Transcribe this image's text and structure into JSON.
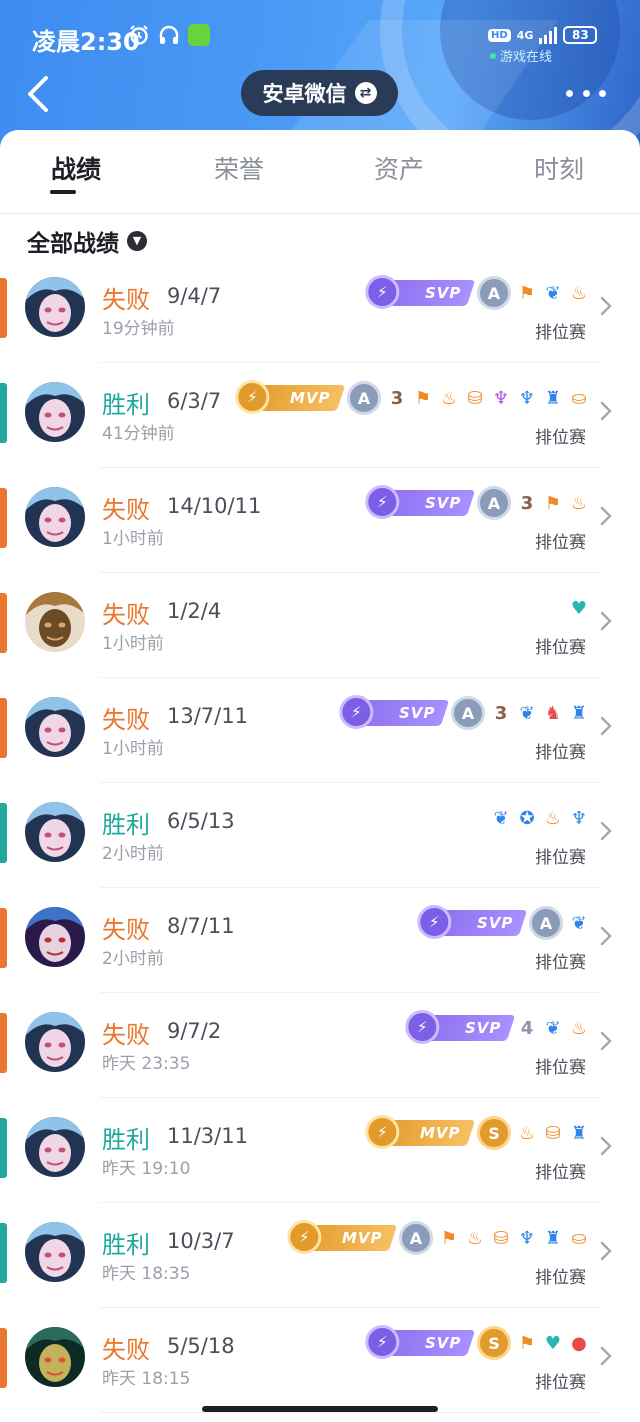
{
  "status_bar": {
    "time": "凌晨2:30",
    "icons": [
      "alarm-icon",
      "headset-icon",
      "app-icon"
    ],
    "hd_label": "HD",
    "network": "4G",
    "battery": "83",
    "online_label": "游戏在线"
  },
  "header": {
    "account_switch_label": "安卓微信",
    "icons": [
      "back-arrow-icon",
      "swap-icon",
      "more-dots-icon"
    ]
  },
  "tabs": [
    {
      "label": "战绩",
      "active": true
    },
    {
      "label": "荣誉",
      "active": false
    },
    {
      "label": "资产",
      "active": false
    },
    {
      "label": "时刻",
      "active": false
    }
  ],
  "filter": {
    "label": "全部战绩"
  },
  "colors": {
    "win": "#21a99e",
    "loss": "#e9772d",
    "svp": "#8b6ef0",
    "mvp": "#e39a2c",
    "header": "#3d8cf0"
  },
  "matches": [
    {
      "result": "失败",
      "outcome": "loss",
      "kda": "9/4/7",
      "time": "19分钟前",
      "mode": "排位赛",
      "hero": "jinx",
      "badges": [
        {
          "type": "svp",
          "text": "SVP"
        },
        {
          "type": "grade-a",
          "text": "A"
        },
        {
          "type": "icon",
          "name": "flag-icon",
          "color": "o"
        },
        {
          "type": "icon",
          "name": "wing-icon",
          "color": "b"
        },
        {
          "type": "icon",
          "name": "fire-icon",
          "color": "o"
        }
      ]
    },
    {
      "result": "胜利",
      "outcome": "win",
      "kda": "6/3/7",
      "time": "41分钟前",
      "mode": "排位赛",
      "hero": "jinx",
      "badges": [
        {
          "type": "mvp",
          "text": "MVP"
        },
        {
          "type": "grade-a",
          "text": "A"
        },
        {
          "type": "number",
          "text": "3"
        },
        {
          "type": "icon",
          "name": "flag-icon",
          "color": "o"
        },
        {
          "type": "icon",
          "name": "fire-icon",
          "color": "o"
        },
        {
          "type": "icon",
          "name": "coins-icon",
          "color": "o"
        },
        {
          "type": "icon",
          "name": "demon-icon",
          "color": "p"
        },
        {
          "type": "icon",
          "name": "bird-icon",
          "color": "b"
        },
        {
          "type": "icon",
          "name": "tower-icon",
          "color": "b"
        },
        {
          "type": "icon",
          "name": "gold-icon",
          "color": "o"
        }
      ]
    },
    {
      "result": "失败",
      "outcome": "loss",
      "kda": "14/10/11",
      "time": "1小时前",
      "mode": "排位赛",
      "hero": "jinx",
      "badges": [
        {
          "type": "svp",
          "text": "SVP"
        },
        {
          "type": "grade-a",
          "text": "A"
        },
        {
          "type": "number",
          "text": "3"
        },
        {
          "type": "icon",
          "name": "flag-icon",
          "color": "o"
        },
        {
          "type": "icon",
          "name": "fire-icon",
          "color": "o"
        }
      ]
    },
    {
      "result": "失败",
      "outcome": "loss",
      "kda": "1/2/4",
      "time": "1小时前",
      "mode": "排位赛",
      "hero": "warrior",
      "badges": [
        {
          "type": "icon",
          "name": "heal-heart-icon",
          "color": "t"
        }
      ]
    },
    {
      "result": "失败",
      "outcome": "loss",
      "kda": "13/7/11",
      "time": "1小时前",
      "mode": "排位赛",
      "hero": "jinx",
      "badges": [
        {
          "type": "svp",
          "text": "SVP"
        },
        {
          "type": "grade-a",
          "text": "A"
        },
        {
          "type": "number",
          "text": "3"
        },
        {
          "type": "icon",
          "name": "wing-icon",
          "color": "b"
        },
        {
          "type": "icon",
          "name": "claw-icon",
          "color": "r"
        },
        {
          "type": "icon",
          "name": "tower-icon",
          "color": "b"
        }
      ]
    },
    {
      "result": "胜利",
      "outcome": "win",
      "kda": "6/5/13",
      "time": "2小时前",
      "mode": "排位赛",
      "hero": "jinx",
      "badges": [
        {
          "type": "icon",
          "name": "wing-icon",
          "color": "b"
        },
        {
          "type": "icon",
          "name": "shield-wing-icon",
          "color": "b"
        },
        {
          "type": "icon",
          "name": "fire-icon",
          "color": "o"
        },
        {
          "type": "icon",
          "name": "bird-icon",
          "color": "b"
        }
      ]
    },
    {
      "result": "失败",
      "outcome": "loss",
      "kda": "8/7/11",
      "time": "2小时前",
      "mode": "排位赛",
      "hero": "mage",
      "badges": [
        {
          "type": "svp",
          "text": "SVP"
        },
        {
          "type": "grade-a",
          "text": "A"
        },
        {
          "type": "icon",
          "name": "wing-icon",
          "color": "b"
        }
      ]
    },
    {
      "result": "失败",
      "outcome": "loss",
      "kda": "9/7/2",
      "time": "昨天 23:35",
      "mode": "排位赛",
      "hero": "jinx",
      "badges": [
        {
          "type": "svp",
          "text": "SVP"
        },
        {
          "type": "number",
          "text": "4",
          "color": "g"
        },
        {
          "type": "icon",
          "name": "wing-icon",
          "color": "b"
        },
        {
          "type": "icon",
          "name": "fire-icon",
          "color": "o"
        }
      ]
    },
    {
      "result": "胜利",
      "outcome": "win",
      "kda": "11/3/11",
      "time": "昨天 19:10",
      "mode": "排位赛",
      "hero": "jinx",
      "badges": [
        {
          "type": "mvp",
          "text": "MVP"
        },
        {
          "type": "grade-s",
          "text": "S"
        },
        {
          "type": "icon",
          "name": "fire-icon",
          "color": "o"
        },
        {
          "type": "icon",
          "name": "coins-icon",
          "color": "o"
        },
        {
          "type": "icon",
          "name": "tower-icon",
          "color": "b"
        }
      ]
    },
    {
      "result": "胜利",
      "outcome": "win",
      "kda": "10/3/7",
      "time": "昨天 18:35",
      "mode": "排位赛",
      "hero": "jinx",
      "badges": [
        {
          "type": "mvp",
          "text": "MVP"
        },
        {
          "type": "grade-a",
          "text": "A"
        },
        {
          "type": "icon",
          "name": "flag-icon",
          "color": "o"
        },
        {
          "type": "icon",
          "name": "fire-icon",
          "color": "o"
        },
        {
          "type": "icon",
          "name": "coins-icon",
          "color": "o"
        },
        {
          "type": "icon",
          "name": "bird-icon",
          "color": "b"
        },
        {
          "type": "icon",
          "name": "tower-icon",
          "color": "b"
        },
        {
          "type": "icon",
          "name": "gold-icon",
          "color": "o"
        }
      ]
    },
    {
      "result": "失败",
      "outcome": "loss",
      "kda": "5/5/18",
      "time": "昨天 18:15",
      "mode": "排位赛",
      "hero": "masked",
      "badges": [
        {
          "type": "svp",
          "text": "SVP"
        },
        {
          "type": "grade-s",
          "text": "S"
        },
        {
          "type": "icon",
          "name": "flag-icon",
          "color": "o"
        },
        {
          "type": "icon",
          "name": "heal-heart-icon",
          "color": "t"
        },
        {
          "type": "icon",
          "name": "blood-drop-icon",
          "color": "r"
        }
      ]
    }
  ]
}
